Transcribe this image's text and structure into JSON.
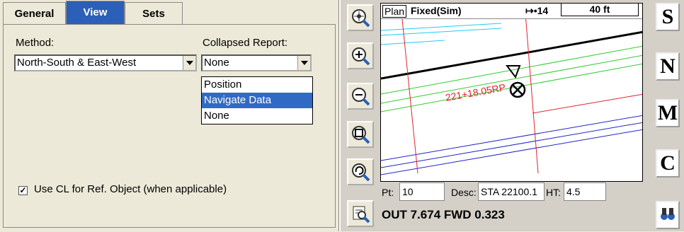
{
  "left_panel": {
    "tabs": [
      {
        "label": "General"
      },
      {
        "label": "View",
        "active": true
      },
      {
        "label": "Sets"
      }
    ],
    "method": {
      "label": "Method:",
      "value": "North-South & East-West"
    },
    "collapsed_report": {
      "label": "Collapsed Report:",
      "value": "None",
      "options": [
        "Position",
        "Navigate Data",
        "None"
      ],
      "highlighted": "Navigate Data"
    },
    "use_cl": {
      "checked": true,
      "label": "Use CL for Ref. Object (when applicable)"
    }
  },
  "map_panel": {
    "view_label": "Plan",
    "fix_status": "Fixed(Sim)",
    "sat_icon": "satellite-icon",
    "sat_count": "14",
    "scale": "40 ft",
    "station_label": "221+18.05RP",
    "pt": {
      "label": "Pt:",
      "value": "10"
    },
    "desc": {
      "label": "Desc:",
      "value": "STA 22100.1"
    },
    "ht": {
      "label": "HT:",
      "value": "4.5"
    },
    "readout": "OUT 7.674 FWD 0.323",
    "right_buttons": [
      "S",
      "N",
      "M",
      "C"
    ],
    "zoom_buttons": [
      "zoom-target-icon",
      "zoom-in-icon",
      "zoom-out-icon",
      "zoom-window-icon",
      "zoom-previous-icon",
      "zoom-extents-icon"
    ]
  },
  "colors": {
    "active_tab": "#2b5fb8",
    "highlight": "#316ac5",
    "line_red": "#e0242c",
    "line_green": "#2ecc2e",
    "line_blue": "#2222cc",
    "line_cyan": "#22ccee"
  }
}
